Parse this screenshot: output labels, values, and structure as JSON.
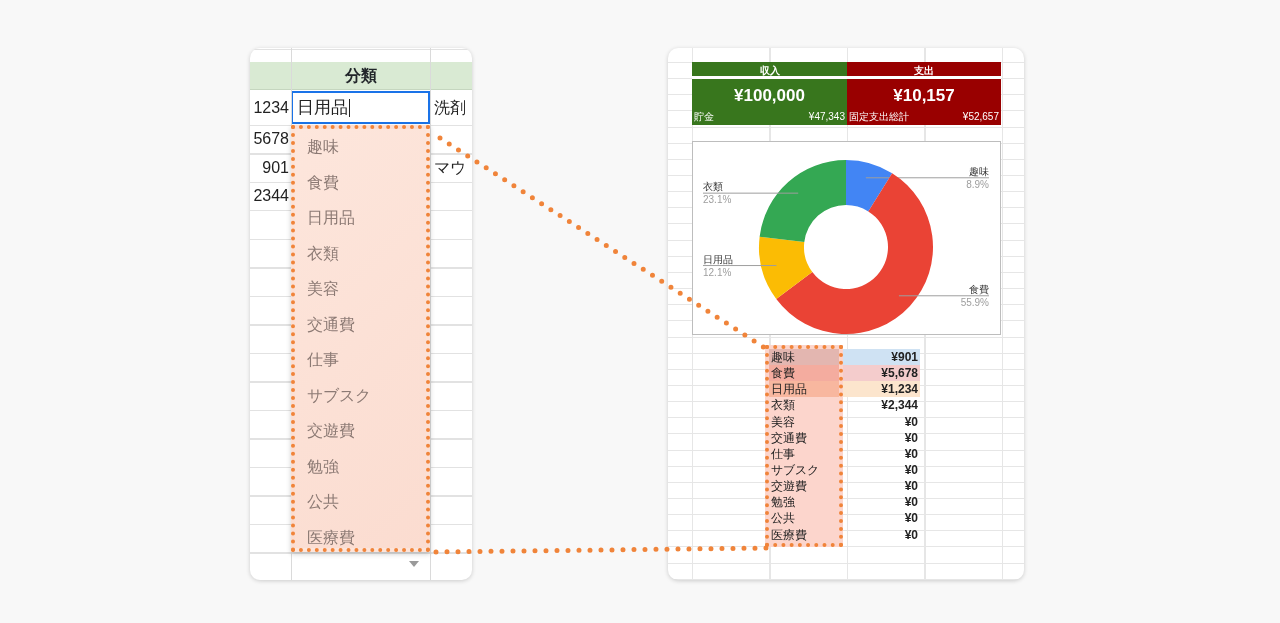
{
  "left_sheet": {
    "column_header": "分類",
    "editor": {
      "value": "日用品"
    },
    "rows": [
      {
        "column_1": "1234",
        "column_3": "洗剤"
      },
      {
        "column_1": "5678"
      },
      {
        "column_1": "901",
        "column_3": "マウ"
      },
      {
        "column_1": "2344"
      }
    ],
    "dropdown": {
      "options": [
        "趣味",
        "食費",
        "日用品",
        "衣類",
        "美容",
        "交通費",
        "仕事",
        "サブスク",
        "交遊費",
        "勉強",
        "公共",
        "医療費"
      ]
    }
  },
  "right_sheet": {
    "summary": [
      {
        "kind": "income",
        "label": "収入",
        "amount": "¥100,000",
        "sub_label": "貯金",
        "sub_amount": "¥47,343"
      },
      {
        "kind": "expense",
        "label": "支出",
        "amount": "¥10,157",
        "sub_label": "固定支出総計",
        "sub_amount": "¥52,657"
      }
    ],
    "chart": {
      "chart_data": {
        "type": "donut",
        "categories": [
          "趣味",
          "食費",
          "日用品",
          "衣類"
        ],
        "values": [
          8.9,
          55.9,
          12.1,
          23.1
        ],
        "colors": [
          "#4285f4",
          "#ea4335",
          "#fbbc04",
          "#34a853"
        ],
        "value_labels": [
          "8.9%",
          "55.9%",
          "12.1%",
          "23.1%"
        ]
      }
    },
    "category_table": {
      "rows": [
        {
          "category": "趣味",
          "amount": "¥901",
          "color": "#cfe2f3"
        },
        {
          "category": "食費",
          "amount": "¥5,678",
          "color": "#f4cccc"
        },
        {
          "category": "日用品",
          "amount": "¥1,234",
          "color": "#fce5cd"
        },
        {
          "category": "衣類",
          "amount": "¥2,344"
        },
        {
          "category": "美容",
          "amount": "¥0"
        },
        {
          "category": "交通費",
          "amount": "¥0"
        },
        {
          "category": "仕事",
          "amount": "¥0"
        },
        {
          "category": "サブスク",
          "amount": "¥0"
        },
        {
          "category": "交遊費",
          "amount": "¥0"
        },
        {
          "category": "勉強",
          "amount": "¥0"
        },
        {
          "category": "公共",
          "amount": "¥0"
        },
        {
          "category": "医療費",
          "amount": "¥0"
        }
      ]
    }
  }
}
